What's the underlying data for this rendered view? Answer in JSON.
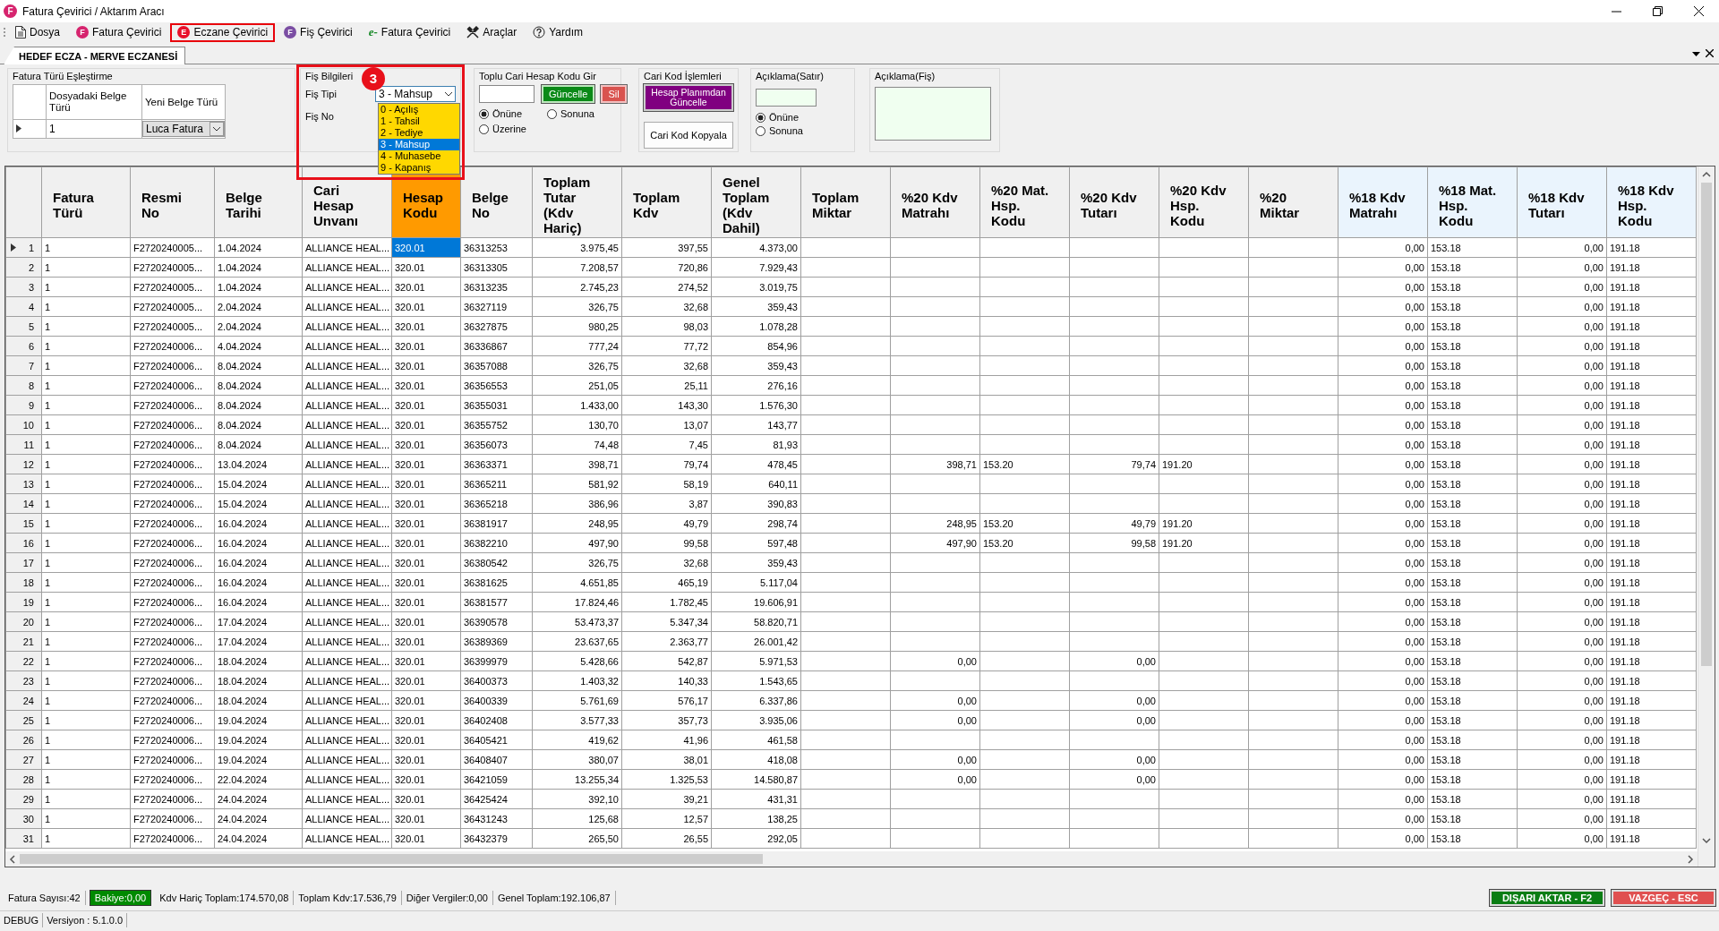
{
  "window": {
    "title": "Fatura Çevirici / Aktarım Aracı",
    "icon_letter": "F"
  },
  "menu": [
    {
      "label": "Dosya",
      "kind": "document",
      "selected": false
    },
    {
      "label": "Fatura Çevirici",
      "kind": "badge",
      "badge": "F",
      "color": "#d6246e",
      "selected": false
    },
    {
      "label": "Eczane Çevirici",
      "kind": "badge",
      "badge": "E",
      "color": "#e8102a",
      "selected": true
    },
    {
      "label": "Fiş Çevirici",
      "kind": "badge",
      "badge": "F",
      "color": "#7b4ea3",
      "selected": false
    },
    {
      "label": "Fatura Çevirici",
      "kind": "einvoice",
      "badge": "e-",
      "selected": false
    },
    {
      "label": "Araçlar",
      "kind": "tools",
      "selected": false
    },
    {
      "label": "Yardım",
      "kind": "help",
      "selected": false
    }
  ],
  "document_tab": {
    "label": "HEDEF ECZA - MERVE ECZANESİ",
    "selected": true
  },
  "invoice_type_mapping": {
    "title": "Fatura Türü Eşleştirme",
    "columns": [
      "Dosyadaki Belge Türü",
      "Yeni Belge Türü"
    ],
    "rows": [
      {
        "current": true,
        "source_type": "1",
        "new_type": "Luca Fatura"
      }
    ]
  },
  "receipt_info": {
    "title": "Fiş Bilgileri",
    "highlighted": true,
    "step_badge": "3",
    "type_label": "Fiş Tipi",
    "type_value": "3 - Mahsup",
    "expanded": true,
    "options": [
      {
        "label": "0 - Açılış",
        "selected": false
      },
      {
        "label": "1 - Tahsil",
        "selected": false
      },
      {
        "label": "2 - Tediye",
        "selected": false
      },
      {
        "label": "3 - Mahsup",
        "selected": true
      },
      {
        "label": "4 - Muhasebe",
        "selected": false
      },
      {
        "label": "9 - Kapanış",
        "selected": false
      }
    ],
    "number_label": "Fiş No"
  },
  "bulk_account_code": {
    "title": "Toplu Cari Hesap Kodu Gir",
    "update_button": "Güncelle",
    "delete_button": "Sil",
    "positions": [
      {
        "label": "Önüne",
        "selected": true
      },
      {
        "label": "Sonuna",
        "selected": false
      },
      {
        "label": "Üzerine",
        "selected": false
      }
    ]
  },
  "account_code_ops": {
    "title": "Cari Kod İşlemleri",
    "buttons": [
      {
        "label": "Hesap Planımdan Güncelle",
        "kind": "accent"
      },
      {
        "label": "Cari Kod Kopyala",
        "kind": "plain"
      }
    ]
  },
  "line_description": {
    "title": "Açıklama(Satır)",
    "positions": [
      {
        "label": "Önüne",
        "selected": true
      },
      {
        "label": "Sonuna",
        "selected": false
      }
    ]
  },
  "receipt_description": {
    "title": "Açıklama(Fiş)"
  },
  "table": {
    "columns": [
      {
        "label": "Fatura Türü",
        "kind": "plain"
      },
      {
        "label": "Resmi No",
        "kind": "plain"
      },
      {
        "label": "Belge Tarihi",
        "kind": "plain"
      },
      {
        "label": "Cari Hesap Unvanı",
        "kind": "plain"
      },
      {
        "label": "Hesap Kodu",
        "kind": "current"
      },
      {
        "label": "Belge No",
        "kind": "plain"
      },
      {
        "label": "Toplam Tutar (Kdv Hariç)",
        "kind": "plain"
      },
      {
        "label": "Toplam Kdv",
        "kind": "plain"
      },
      {
        "label": "Genel Toplam (Kdv Dahil)",
        "kind": "plain"
      },
      {
        "label": "Toplam Miktar",
        "kind": "plain"
      },
      {
        "label": "%20 Kdv Matrahı",
        "kind": "plain"
      },
      {
        "label": "%20 Mat. Hsp. Kodu",
        "kind": "plain"
      },
      {
        "label": "%20 Kdv Tutarı",
        "kind": "plain"
      },
      {
        "label": "%20 Kdv Hsp. Kodu",
        "kind": "plain"
      },
      {
        "label": "%20 Miktar",
        "kind": "plain"
      },
      {
        "label": "%18 Kdv Matrahı",
        "kind": "tinted"
      },
      {
        "label": "%18 Mat. Hsp. Kodu",
        "kind": "tinted"
      },
      {
        "label": "%18 Kdv Tutarı",
        "kind": "tinted"
      },
      {
        "label": "%18 Kdv Hsp. Kodu",
        "kind": "tinted"
      }
    ],
    "rows": [
      {
        "number": "1",
        "current": true,
        "cells": [
          "1",
          "F2720240005...",
          "1.04.2024",
          "ALLIANCE HEAL...",
          "320.01",
          "36313253",
          "3.975,45",
          "397,55",
          "4.373,00",
          null,
          null,
          null,
          null,
          null,
          null,
          "0,00",
          "153.18",
          "0,00",
          "191.18"
        ]
      },
      {
        "number": "2",
        "current": false,
        "cells": [
          "1",
          "F2720240005...",
          "1.04.2024",
          "ALLIANCE HEAL...",
          "320.01",
          "36313305",
          "7.208,57",
          "720,86",
          "7.929,43",
          null,
          null,
          null,
          null,
          null,
          null,
          "0,00",
          "153.18",
          "0,00",
          "191.18"
        ]
      },
      {
        "number": "3",
        "current": false,
        "cells": [
          "1",
          "F2720240005...",
          "1.04.2024",
          "ALLIANCE HEAL...",
          "320.01",
          "36313235",
          "2.745,23",
          "274,52",
          "3.019,75",
          null,
          null,
          null,
          null,
          null,
          null,
          "0,00",
          "153.18",
          "0,00",
          "191.18"
        ]
      },
      {
        "number": "4",
        "current": false,
        "cells": [
          "1",
          "F2720240005...",
          "2.04.2024",
          "ALLIANCE HEAL...",
          "320.01",
          "36327119",
          "326,75",
          "32,68",
          "359,43",
          null,
          null,
          null,
          null,
          null,
          null,
          "0,00",
          "153.18",
          "0,00",
          "191.18"
        ]
      },
      {
        "number": "5",
        "current": false,
        "cells": [
          "1",
          "F2720240005...",
          "2.04.2024",
          "ALLIANCE HEAL...",
          "320.01",
          "36327875",
          "980,25",
          "98,03",
          "1.078,28",
          null,
          null,
          null,
          null,
          null,
          null,
          "0,00",
          "153.18",
          "0,00",
          "191.18"
        ]
      },
      {
        "number": "6",
        "current": false,
        "cells": [
          "1",
          "F2720240006...",
          "4.04.2024",
          "ALLIANCE HEAL...",
          "320.01",
          "36336867",
          "777,24",
          "77,72",
          "854,96",
          null,
          null,
          null,
          null,
          null,
          null,
          "0,00",
          "153.18",
          "0,00",
          "191.18"
        ]
      },
      {
        "number": "7",
        "current": false,
        "cells": [
          "1",
          "F2720240006...",
          "8.04.2024",
          "ALLIANCE HEAL...",
          "320.01",
          "36357088",
          "326,75",
          "32,68",
          "359,43",
          null,
          null,
          null,
          null,
          null,
          null,
          "0,00",
          "153.18",
          "0,00",
          "191.18"
        ]
      },
      {
        "number": "8",
        "current": false,
        "cells": [
          "1",
          "F2720240006...",
          "8.04.2024",
          "ALLIANCE HEAL...",
          "320.01",
          "36356553",
          "251,05",
          "25,11",
          "276,16",
          null,
          null,
          null,
          null,
          null,
          null,
          "0,00",
          "153.18",
          "0,00",
          "191.18"
        ]
      },
      {
        "number": "9",
        "current": false,
        "cells": [
          "1",
          "F2720240006...",
          "8.04.2024",
          "ALLIANCE HEAL...",
          "320.01",
          "36355031",
          "1.433,00",
          "143,30",
          "1.576,30",
          null,
          null,
          null,
          null,
          null,
          null,
          "0,00",
          "153.18",
          "0,00",
          "191.18"
        ]
      },
      {
        "number": "10",
        "current": false,
        "cells": [
          "1",
          "F2720240006...",
          "8.04.2024",
          "ALLIANCE HEAL...",
          "320.01",
          "36355752",
          "130,70",
          "13,07",
          "143,77",
          null,
          null,
          null,
          null,
          null,
          null,
          "0,00",
          "153.18",
          "0,00",
          "191.18"
        ]
      },
      {
        "number": "11",
        "current": false,
        "cells": [
          "1",
          "F2720240006...",
          "8.04.2024",
          "ALLIANCE HEAL...",
          "320.01",
          "36356073",
          "74,48",
          "7,45",
          "81,93",
          null,
          null,
          null,
          null,
          null,
          null,
          "0,00",
          "153.18",
          "0,00",
          "191.18"
        ]
      },
      {
        "number": "12",
        "current": false,
        "cells": [
          "1",
          "F2720240006...",
          "13.04.2024",
          "ALLIANCE HEAL...",
          "320.01",
          "36363371",
          "398,71",
          "79,74",
          "478,45",
          null,
          "398,71",
          "153.20",
          "79,74",
          "191.20",
          null,
          "0,00",
          "153.18",
          "0,00",
          "191.18"
        ]
      },
      {
        "number": "13",
        "current": false,
        "cells": [
          "1",
          "F2720240006...",
          "15.04.2024",
          "ALLIANCE HEAL...",
          "320.01",
          "36365211",
          "581,92",
          "58,19",
          "640,11",
          null,
          null,
          null,
          null,
          null,
          null,
          "0,00",
          "153.18",
          "0,00",
          "191.18"
        ]
      },
      {
        "number": "14",
        "current": false,
        "cells": [
          "1",
          "F2720240006...",
          "15.04.2024",
          "ALLIANCE HEAL...",
          "320.01",
          "36365218",
          "386,96",
          "3,87",
          "390,83",
          null,
          null,
          null,
          null,
          null,
          null,
          "0,00",
          "153.18",
          "0,00",
          "191.18"
        ]
      },
      {
        "number": "15",
        "current": false,
        "cells": [
          "1",
          "F2720240006...",
          "16.04.2024",
          "ALLIANCE HEAL...",
          "320.01",
          "36381917",
          "248,95",
          "49,79",
          "298,74",
          null,
          "248,95",
          "153.20",
          "49,79",
          "191.20",
          null,
          "0,00",
          "153.18",
          "0,00",
          "191.18"
        ]
      },
      {
        "number": "16",
        "current": false,
        "cells": [
          "1",
          "F2720240006...",
          "16.04.2024",
          "ALLIANCE HEAL...",
          "320.01",
          "36382210",
          "497,90",
          "99,58",
          "597,48",
          null,
          "497,90",
          "153.20",
          "99,58",
          "191.20",
          null,
          "0,00",
          "153.18",
          "0,00",
          "191.18"
        ]
      },
      {
        "number": "17",
        "current": false,
        "cells": [
          "1",
          "F2720240006...",
          "16.04.2024",
          "ALLIANCE HEAL...",
          "320.01",
          "36380542",
          "326,75",
          "32,68",
          "359,43",
          null,
          null,
          null,
          null,
          null,
          null,
          "0,00",
          "153.18",
          "0,00",
          "191.18"
        ]
      },
      {
        "number": "18",
        "current": false,
        "cells": [
          "1",
          "F2720240006...",
          "16.04.2024",
          "ALLIANCE HEAL...",
          "320.01",
          "36381625",
          "4.651,85",
          "465,19",
          "5.117,04",
          null,
          null,
          null,
          null,
          null,
          null,
          "0,00",
          "153.18",
          "0,00",
          "191.18"
        ]
      },
      {
        "number": "19",
        "current": false,
        "cells": [
          "1",
          "F2720240006...",
          "16.04.2024",
          "ALLIANCE HEAL...",
          "320.01",
          "36381577",
          "17.824,46",
          "1.782,45",
          "19.606,91",
          null,
          null,
          null,
          null,
          null,
          null,
          "0,00",
          "153.18",
          "0,00",
          "191.18"
        ]
      },
      {
        "number": "20",
        "current": false,
        "cells": [
          "1",
          "F2720240006...",
          "17.04.2024",
          "ALLIANCE HEAL...",
          "320.01",
          "36390578",
          "53.473,37",
          "5.347,34",
          "58.820,71",
          null,
          null,
          null,
          null,
          null,
          null,
          "0,00",
          "153.18",
          "0,00",
          "191.18"
        ]
      },
      {
        "number": "21",
        "current": false,
        "cells": [
          "1",
          "F2720240006...",
          "17.04.2024",
          "ALLIANCE HEAL...",
          "320.01",
          "36389369",
          "23.637,65",
          "2.363,77",
          "26.001,42",
          null,
          null,
          null,
          null,
          null,
          null,
          "0,00",
          "153.18",
          "0,00",
          "191.18"
        ]
      },
      {
        "number": "22",
        "current": false,
        "cells": [
          "1",
          "F2720240006...",
          "18.04.2024",
          "ALLIANCE HEAL...",
          "320.01",
          "36399979",
          "5.428,66",
          "542,87",
          "5.971,53",
          null,
          "0,00",
          null,
          "0,00",
          null,
          null,
          "0,00",
          "153.18",
          "0,00",
          "191.18"
        ]
      },
      {
        "number": "23",
        "current": false,
        "cells": [
          "1",
          "F2720240006...",
          "18.04.2024",
          "ALLIANCE HEAL...",
          "320.01",
          "36400373",
          "1.403,32",
          "140,33",
          "1.543,65",
          null,
          null,
          null,
          null,
          null,
          null,
          "0,00",
          "153.18",
          "0,00",
          "191.18"
        ]
      },
      {
        "number": "24",
        "current": false,
        "cells": [
          "1",
          "F2720240006...",
          "18.04.2024",
          "ALLIANCE HEAL...",
          "320.01",
          "36400339",
          "5.761,69",
          "576,17",
          "6.337,86",
          null,
          "0,00",
          null,
          "0,00",
          null,
          null,
          "0,00",
          "153.18",
          "0,00",
          "191.18"
        ]
      },
      {
        "number": "25",
        "current": false,
        "cells": [
          "1",
          "F2720240006...",
          "19.04.2024",
          "ALLIANCE HEAL...",
          "320.01",
          "36402408",
          "3.577,33",
          "357,73",
          "3.935,06",
          null,
          "0,00",
          null,
          "0,00",
          null,
          null,
          "0,00",
          "153.18",
          "0,00",
          "191.18"
        ]
      },
      {
        "number": "26",
        "current": false,
        "cells": [
          "1",
          "F2720240006...",
          "19.04.2024",
          "ALLIANCE HEAL...",
          "320.01",
          "36405421",
          "419,62",
          "41,96",
          "461,58",
          null,
          null,
          null,
          null,
          null,
          null,
          "0,00",
          "153.18",
          "0,00",
          "191.18"
        ]
      },
      {
        "number": "27",
        "current": false,
        "cells": [
          "1",
          "F2720240006...",
          "19.04.2024",
          "ALLIANCE HEAL...",
          "320.01",
          "36408407",
          "380,07",
          "38,01",
          "418,08",
          null,
          "0,00",
          null,
          "0,00",
          null,
          null,
          "0,00",
          "153.18",
          "0,00",
          "191.18"
        ]
      },
      {
        "number": "28",
        "current": false,
        "cells": [
          "1",
          "F2720240006...",
          "22.04.2024",
          "ALLIANCE HEAL...",
          "320.01",
          "36421059",
          "13.255,34",
          "1.325,53",
          "14.580,87",
          null,
          "0,00",
          null,
          "0,00",
          null,
          null,
          "0,00",
          "153.18",
          "0,00",
          "191.18"
        ]
      },
      {
        "number": "29",
        "current": false,
        "cells": [
          "1",
          "F2720240006...",
          "24.04.2024",
          "ALLIANCE HEAL...",
          "320.01",
          "36425424",
          "392,10",
          "39,21",
          "431,31",
          null,
          null,
          null,
          null,
          null,
          null,
          "0,00",
          "153.18",
          "0,00",
          "191.18"
        ]
      },
      {
        "number": "30",
        "current": false,
        "cells": [
          "1",
          "F2720240006...",
          "24.04.2024",
          "ALLIANCE HEAL...",
          "320.01",
          "36431243",
          "125,68",
          "12,57",
          "138,25",
          null,
          null,
          null,
          null,
          null,
          null,
          "0,00",
          "153.18",
          "0,00",
          "191.18"
        ]
      },
      {
        "number": "31",
        "current": false,
        "cells": [
          "1",
          "F2720240006...",
          "24.04.2024",
          "ALLIANCE HEAL...",
          "320.01",
          "36432379",
          "265,50",
          "26,55",
          "292,05",
          null,
          null,
          null,
          null,
          null,
          null,
          "0,00",
          "153.18",
          "0,00",
          "191.18"
        ]
      }
    ]
  },
  "status_bar": {
    "items": [
      {
        "text": "Fatura Sayısı:42",
        "kind": "plain"
      },
      {
        "text": "Bakiye:0,00",
        "kind": "ok"
      },
      {
        "text": "Kdv Hariç Toplam:174.570,08",
        "kind": "plain"
      },
      {
        "text": "Toplam Kdv:17.536,79",
        "kind": "plain"
      },
      {
        "text": "Diğer Vergiler:0,00",
        "kind": "plain"
      },
      {
        "text": "Genel Toplam:192.106,87",
        "kind": "plain"
      }
    ],
    "buttons": [
      {
        "label": "DIŞARI AKTAR - F2",
        "kind": "confirm"
      },
      {
        "label": "VAZGEÇ - ESC",
        "kind": "cancel"
      }
    ]
  },
  "footer": [
    "DEBUG",
    "Versiyon : 5.1.0.0"
  ]
}
